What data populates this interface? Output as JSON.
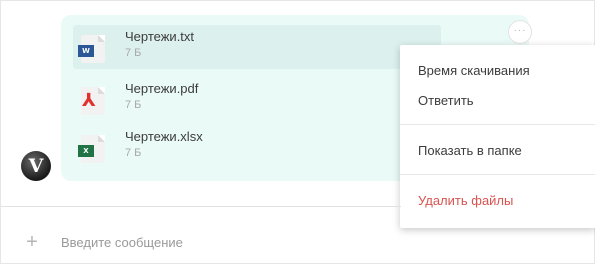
{
  "message": {
    "files": [
      {
        "name": "Чертежи.txt",
        "size": "7 Б",
        "icon": "word-doc-icon",
        "badge": "W"
      },
      {
        "name": "Чертежи.pdf",
        "size": "7 Б",
        "icon": "pdf-icon",
        "badge": "⅄"
      },
      {
        "name": "Чертежи.xlsx",
        "size": "7 Б",
        "icon": "excel-icon",
        "badge": "X"
      }
    ],
    "avatar_letter": "V",
    "more_button_glyph": "···"
  },
  "context_menu": {
    "items": [
      "Время скачивания",
      "Ответить",
      "Показать в папке",
      "Удалить файлы"
    ]
  },
  "composer": {
    "plus_glyph": "+",
    "placeholder": "Введите сообщение"
  },
  "colors": {
    "bubble_bg": "#eafaf7",
    "selected_row_bg": "#dcf1ee",
    "danger": "#d9534f",
    "word": "#2b5797",
    "excel": "#217346",
    "pdf": "#e0312f"
  }
}
